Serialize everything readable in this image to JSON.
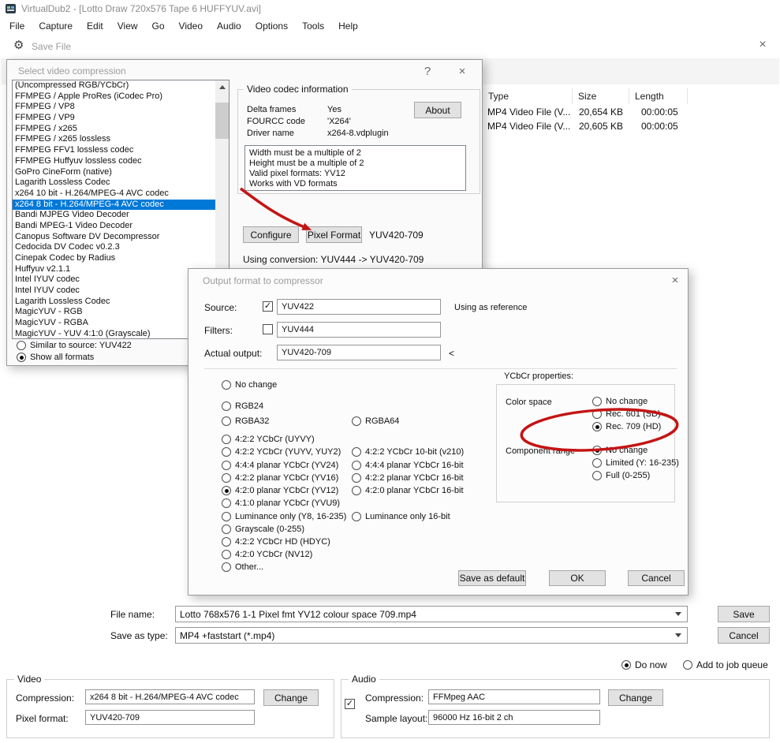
{
  "colors": {
    "selection": "#0078d7",
    "annotation": "#c41414"
  },
  "icons": {
    "close": "×",
    "help": "?",
    "check": "✓",
    "gear": "⚙"
  },
  "window": {
    "title": "VirtualDub2 - [Lotto Draw 720x576 Tape 6 HUFFYUV.avi]",
    "menu": [
      "File",
      "Capture",
      "Edit",
      "View",
      "Go",
      "Video",
      "Audio",
      "Options",
      "Tools",
      "Help"
    ]
  },
  "save_dialog": {
    "title": "Save File",
    "columns": {
      "type": "Type",
      "size": "Size",
      "length": "Length"
    },
    "files": [
      {
        "type": "MP4 Video File (V...",
        "size": "20,654 KB",
        "length": "00:00:05"
      },
      {
        "type": "MP4 Video File (V...",
        "size": "20,605 KB",
        "length": "00:00:05"
      }
    ],
    "file_name_label": "File name:",
    "file_name": "Lotto 768x576 1-1 Pixel fmt YV12 colour space 709.mp4",
    "save_as_type_label": "Save as type:",
    "save_as_type": "MP4 +faststart (*.mp4)",
    "save": "Save",
    "cancel": "Cancel",
    "do_now": "Do now",
    "add_to_job_queue": "Add to job queue",
    "video": {
      "label": "Video",
      "compression_label": "Compression:",
      "compression": "x264 8 bit - H.264/MPEG-4 AVC codec",
      "change": "Change",
      "pixel_format_label": "Pixel format:",
      "pixel_format": "YUV420-709"
    },
    "audio": {
      "label": "Audio",
      "compression_label": "Compression:",
      "compression": "FFMpeg AAC",
      "change": "Change",
      "sample_layout_label": "Sample layout:",
      "sample_layout": "96000 Hz 16-bit 2 ch"
    }
  },
  "compression_dialog": {
    "title": "Select video compression",
    "codecs": [
      "(Uncompressed RGB/YCbCr)",
      "FFMPEG / Apple ProRes (iCodec Pro)",
      "FFMPEG / VP8",
      "FFMPEG / VP9",
      "FFMPEG / x265",
      "FFMPEG / x265 lossless",
      "FFMPEG FFV1 lossless codec",
      "FFMPEG Huffyuv lossless codec",
      "GoPro CineForm (native)",
      "Lagarith Lossless Codec",
      "x264 10 bit - H.264/MPEG-4 AVC codec",
      "x264 8 bit - H.264/MPEG-4 AVC codec",
      "Bandi MJPEG Video Decoder",
      "Bandi MPEG-1 Video Decoder",
      "Canopus Software DV Decompressor",
      "Cedocida DV Codec v0.2.3",
      "Cinepak Codec by Radius",
      "Huffyuv v2.1.1",
      "Intel IYUV codec",
      "Intel IYUV codec",
      "Lagarith Lossless Codec",
      "MagicYUV - RGB",
      "MagicYUV - RGBA",
      "MagicYUV - YUV 4:1:0 (Grayscale)"
    ],
    "selected_codec": "x264 8 bit - H.264/MPEG-4 AVC codec",
    "similar_to_source": "Similar to source: YUV422",
    "show_all_formats": "Show all formats",
    "info": {
      "title": "Video codec information",
      "delta_frames_label": "Delta frames",
      "delta_frames": "Yes",
      "fourcc_label": "FOURCC code",
      "fourcc": "'X264'",
      "driver_label": "Driver name",
      "driver": "x264-8.vdplugin",
      "about": "About",
      "notes": [
        "Width must be a multiple of 2",
        "Height must be a multiple of 2",
        "Valid pixel formats: YV12",
        "Works with VD formats"
      ]
    },
    "configure": "Configure",
    "pixel_format_button": "Pixel Format",
    "pixel_format_value": "YUV420-709",
    "conversion": "Using conversion: YUV444 -> YUV420-709"
  },
  "output_dialog": {
    "title": "Output format to compressor",
    "source_label": "Source:",
    "source": "YUV422",
    "source_note": "Using as reference",
    "filters_label": "Filters:",
    "filters": "YUV444",
    "actual_output_label": "Actual output:",
    "actual_output": "YUV420-709",
    "marker": "<",
    "col1": [
      "No change",
      "RGB24",
      "RGBA32",
      "4:2:2 YCbCr (UYVY)",
      "4:2:2 YCbCr (YUYV, YUY2)",
      "4:4:4 planar YCbCr (YV24)",
      "4:2:2 planar YCbCr (YV16)",
      "4:2:0 planar YCbCr (YV12)",
      "4:1:0 planar YCbCr (YVU9)",
      "Luminance only (Y8, 16-235)",
      "Grayscale (0-255)",
      "4:2:2 YCbCr HD (HDYC)",
      "4:2:0 YCbCr (NV12)",
      "Other..."
    ],
    "col1_selected": "4:2:0 planar YCbCr (YV12)",
    "col2": [
      "RGBA64",
      "4:2:2 YCbCr 10-bit (v210)",
      "4:4:4 planar YCbCr 16-bit",
      "4:2:2 planar YCbCr 16-bit",
      "4:2:0 planar YCbCr 16-bit",
      "Luminance only 16-bit"
    ],
    "ycbcr": {
      "title": "YCbCr properties:",
      "color_space_label": "Color space",
      "cs_options": [
        "No change",
        "Rec. 601 (SD)",
        "Rec. 709 (HD)"
      ],
      "cs_selected": "Rec. 709 (HD)",
      "component_range_label": "Component range",
      "cr_options": [
        "No change",
        "Limited (Y: 16-235)",
        "Full (0-255)"
      ],
      "cr_selected": "No change"
    },
    "save_as_default": "Save as default",
    "ok": "OK",
    "cancel": "Cancel"
  }
}
